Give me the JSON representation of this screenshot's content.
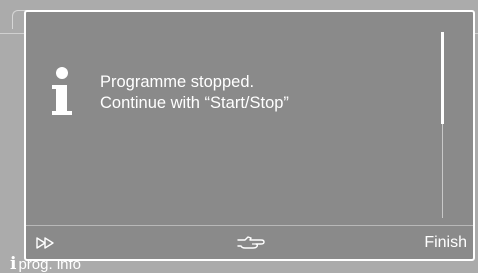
{
  "background": {
    "footer_label": "prog. info"
  },
  "dialog": {
    "message_line1": "Programme stopped.",
    "message_line2": "Continue with “Start/Stop”",
    "info_icon": "info-icon",
    "scroll_position": 0.0,
    "footer": {
      "forward_icon": "fast-forward-icon",
      "hand_icon": "pointing-hand-icon",
      "finish_label": "Finish"
    }
  },
  "colors": {
    "dialog_background": "#8a8a8a",
    "screen_background": "#ababab",
    "foreground": "#ffffff"
  }
}
